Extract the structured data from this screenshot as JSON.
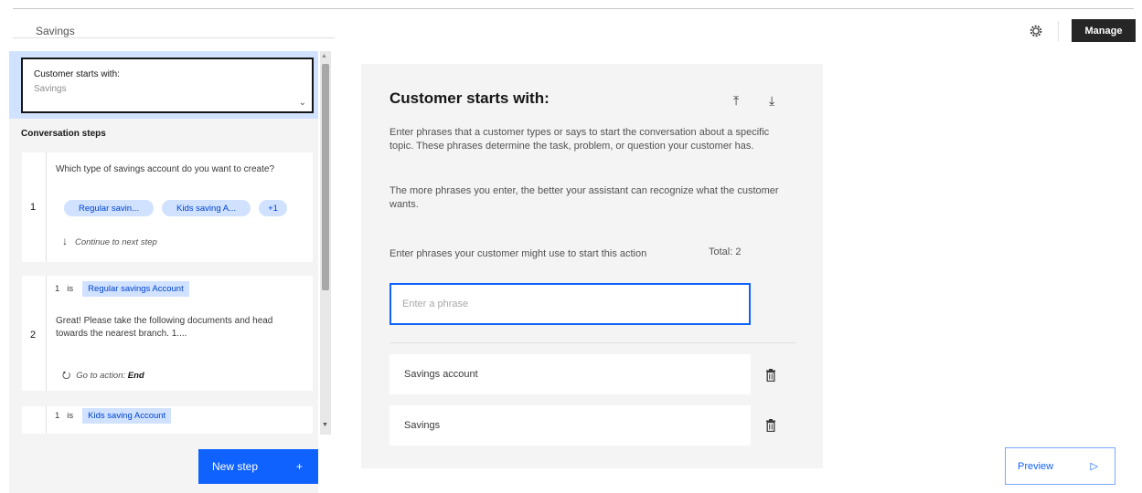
{
  "header": {
    "action_title": "Savings",
    "settings_icon": "gear-icon",
    "manage_label": "Manage"
  },
  "sidebar": {
    "customer_starts": {
      "title": "Customer starts with:",
      "subtitle": "Savings"
    },
    "steps_heading": "Conversation steps",
    "steps": [
      {
        "number": "1",
        "text": "Which type of savings account do you want to create?",
        "options": [
          "Regular savin...",
          "Kids saving A...",
          "+1"
        ],
        "next": "Continue to next step"
      },
      {
        "number": "2",
        "condition": {
          "step": "1",
          "operator": "is",
          "value": "Regular savings Account"
        },
        "text": "Great! Please take the following documents and head towards the nearest branch. 1....",
        "goto_prefix": "Go to action:",
        "goto_target": "End"
      },
      {
        "number": "",
        "condition": {
          "step": "1",
          "operator": "is",
          "value": "Kids saving Account"
        }
      }
    ],
    "new_step_label": "New step",
    "new_step_plus": "+"
  },
  "main": {
    "title": "Customer starts with:",
    "description1": "Enter phrases that a customer types or says to start the conversation about a specific topic. These phrases determine the task, problem, or question your customer has.",
    "description2": "The more phrases you enter, the better your assistant can recognize what the customer wants.",
    "phrase_label": "Enter phrases your customer might use to start this action",
    "total_label": "Total: 2",
    "input_placeholder": "Enter a phrase",
    "input_value": "",
    "phrases": [
      "Savings account",
      "Savings"
    ]
  },
  "preview": {
    "label": "Preview",
    "icon": "play-outline-icon"
  },
  "colors": {
    "primary": "#0f62fe",
    "tag_bg": "#d0e2ff",
    "tag_text": "#0043ce",
    "dark": "#262626"
  }
}
